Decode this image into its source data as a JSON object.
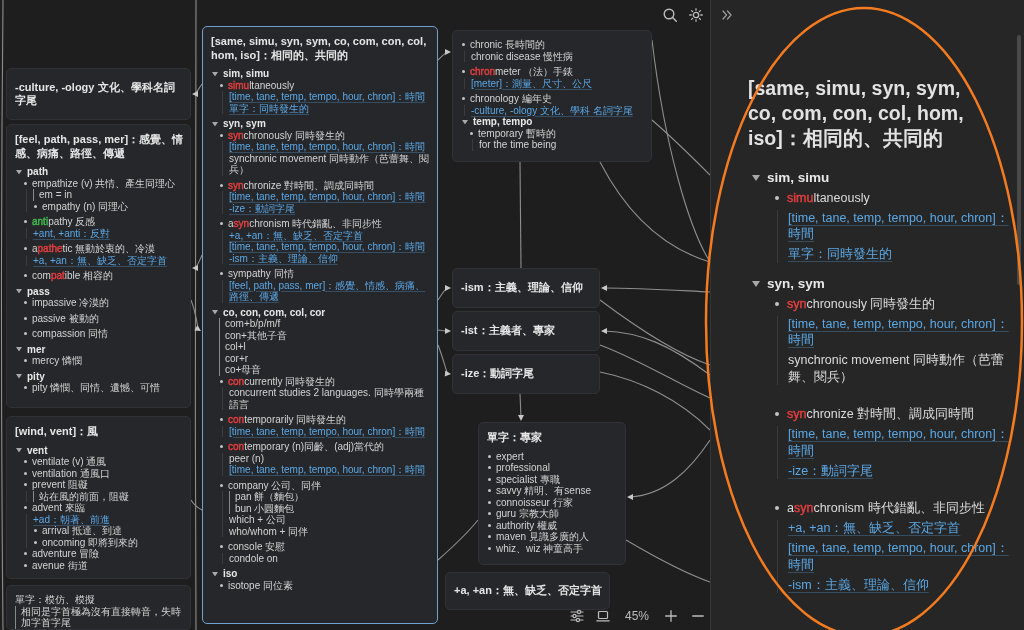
{
  "canvas": {
    "cards": [
      {
        "title": "-culture, -ology 文化、學科名詞字尾",
        "selected": false
      },
      {
        "title": "[feel, path, pass, mer]：感覺、情感、病痛、路徑、傳遞",
        "selected": false,
        "spaced": true,
        "items": [
          {
            "kind": "section",
            "text": "path",
            "expanded": true,
            "children": [
              {
                "kind": "bullet",
                "text": "empathize (v) 共情、產生同理心",
                "children": [
                  {
                    "kind": "quote",
                    "lines": [
                      "em = in"
                    ]
                  },
                  {
                    "kind": "bullet",
                    "text": "empathy (n) 同理心"
                  }
                ]
              },
              {
                "kind": "bullet",
                "parts": [
                  {
                    "text": "anti",
                    "color": "#3fb950"
                  },
                  {
                    "text": "pathy 反感"
                  }
                ],
                "children": [
                  {
                    "kind": "link",
                    "text": "+ant, +anti：反對"
                  }
                ]
              },
              {
                "kind": "bullet",
                "parts": [
                  {
                    "text": "a"
                  },
                  {
                    "text": "pathe",
                    "color": "#e03e3e"
                  },
                  {
                    "text": "tic 無動於衷的、冷漠"
                  }
                ],
                "children": [
                  {
                    "kind": "link",
                    "text": "+a, +an：無、缺乏、否定字首"
                  }
                ]
              },
              {
                "kind": "bullet",
                "parts": [
                  {
                    "text": "com"
                  },
                  {
                    "text": "pat",
                    "color": "#e03e3e"
                  },
                  {
                    "text": "ible 相容的"
                  }
                ]
              }
            ]
          },
          {
            "kind": "section",
            "text": "pass",
            "expanded": true,
            "children": [
              {
                "kind": "bullet",
                "text": "impassive 冷漠的"
              },
              {
                "kind": "bullet",
                "text": "passive 被動的"
              },
              {
                "kind": "bullet",
                "text": "compassion 同情"
              }
            ]
          },
          {
            "kind": "section",
            "text": "mer",
            "expanded": true,
            "children": [
              {
                "kind": "bullet",
                "text": "mercy 憐憫"
              }
            ]
          },
          {
            "kind": "section",
            "text": "pity",
            "expanded": true,
            "children": [
              {
                "kind": "bullet",
                "text": "pity 憐憫、同情、遺憾、可惜"
              }
            ]
          }
        ]
      },
      {
        "title": "[wind, vent]：風",
        "selected": false,
        "spaced": false,
        "items": [
          {
            "kind": "section",
            "text": "vent",
            "expanded": true,
            "children": [
              {
                "kind": "bullet",
                "text": "ventilate (v) 通風"
              },
              {
                "kind": "bullet",
                "text": "ventilation 通風口"
              },
              {
                "kind": "bullet",
                "text": "prevent 阻礙",
                "children": [
                  {
                    "kind": "quote",
                    "lines": [
                      "站在風的前面，阻礙"
                    ]
                  }
                ]
              },
              {
                "kind": "bullet",
                "text": "advent 來臨",
                "children": [
                  {
                    "kind": "link",
                    "text": "+ad：朝著、前進"
                  },
                  {
                    "kind": "bullet",
                    "text": "arrival 抵達、到達"
                  },
                  {
                    "kind": "bullet",
                    "text": "oncoming 即將到來的"
                  }
                ]
              },
              {
                "kind": "bullet",
                "text": "adventure 冒險"
              },
              {
                "kind": "bullet",
                "text": "avenue 街道"
              }
            ]
          }
        ]
      },
      {
        "selected": false,
        "items": [
          {
            "kind": "note",
            "text": "單字：模仿、模擬"
          },
          {
            "kind": "quote",
            "lines": [
              "相同是字首極為沒有直接轉音，失時加字首字尾"
            ]
          }
        ]
      },
      {
        "title": "[same, simu, syn, sym, co, com, con, col, hom, iso]：相同的、共同的",
        "selected": true,
        "spaced": true,
        "items": [
          {
            "kind": "section",
            "text": "sim, simu",
            "expanded": true,
            "children": [
              {
                "kind": "bullet",
                "parts": [
                  {
                    "text": "simu",
                    "color": "#e03e3e"
                  },
                  {
                    "text": "ltaneously"
                  }
                ],
                "children": [
                  {
                    "kind": "link",
                    "text": "[time, tane, temp, tempo, hour, chron]：時間"
                  },
                  {
                    "kind": "link",
                    "text": "單字：同時發生的"
                  }
                ]
              }
            ]
          },
          {
            "kind": "section",
            "text": "syn, sym",
            "expanded": true,
            "children": [
              {
                "kind": "bullet",
                "parts": [
                  {
                    "text": "syn",
                    "color": "#e03e3e"
                  },
                  {
                    "text": "chronously 同時發生的"
                  }
                ],
                "children": [
                  {
                    "kind": "link",
                    "text": "[time, tane, temp, tempo, hour, chron]：時間"
                  },
                  {
                    "kind": "note",
                    "text": "synchronic movement 同時動作（芭蕾舞、閱兵）"
                  }
                ]
              },
              {
                "kind": "bullet",
                "parts": [
                  {
                    "text": "syn",
                    "color": "#e03e3e"
                  },
                  {
                    "text": "chronize 對時間、調成同時間"
                  }
                ],
                "children": [
                  {
                    "kind": "link",
                    "text": "[time, tane, temp, tempo, hour, chron]：時間"
                  },
                  {
                    "kind": "link",
                    "text": "-ize：動詞字尾"
                  }
                ]
              },
              {
                "kind": "bullet",
                "parts": [
                  {
                    "text": "a"
                  },
                  {
                    "text": "syn",
                    "color": "#e03e3e"
                  },
                  {
                    "text": "chronism 時代錯亂、非同步性"
                  }
                ],
                "children": [
                  {
                    "kind": "link",
                    "text": "+a, +an：無、缺乏、否定字首"
                  },
                  {
                    "kind": "link",
                    "text": "[time, tane, temp, tempo, hour, chron]：時間"
                  },
                  {
                    "kind": "link",
                    "text": "-ism：主義、理論、信仰"
                  }
                ]
              },
              {
                "kind": "bullet",
                "text": "sympathy 同情",
                "children": [
                  {
                    "kind": "link",
                    "text": "[feel, path, pass, mer]：感覺、情感、病痛、路徑、傳遞"
                  }
                ]
              }
            ]
          },
          {
            "kind": "section",
            "text": "co, con, com, col, cor",
            "expanded": true,
            "children": [
              {
                "kind": "quote",
                "lines": [
                  "com+b/p/m/f",
                  "con+其他子音",
                  "col+l",
                  "cor+r",
                  "co+母音"
                ]
              },
              {
                "kind": "bullet",
                "parts": [
                  {
                    "text": "con",
                    "color": "#e03e3e"
                  },
                  {
                    "text": "currently 同時發生的"
                  }
                ],
                "children": [
                  {
                    "kind": "note",
                    "text": "concurrent studies 2 languages. 同時學兩種語言"
                  }
                ]
              },
              {
                "kind": "bullet",
                "parts": [
                  {
                    "text": "con",
                    "color": "#e03e3e"
                  },
                  {
                    "text": "temporarily 同時發生的"
                  }
                ],
                "children": [
                  {
                    "kind": "link",
                    "text": "[time, tane, temp, tempo, hour, chron]：時間"
                  }
                ]
              },
              {
                "kind": "bullet",
                "parts": [
                  {
                    "text": "con",
                    "color": "#e03e3e"
                  },
                  {
                    "text": "temporary (n)同齡、(adj)當代的"
                  }
                ],
                "children": [
                  {
                    "kind": "note",
                    "text": "peer (n)"
                  },
                  {
                    "kind": "link",
                    "text": "[time, tane, temp, tempo, hour, chron]：時間"
                  }
                ]
              },
              {
                "kind": "bullet",
                "text": "company 公司、同伴",
                "children": [
                  {
                    "kind": "quote",
                    "lines": [
                      "pan 餅（麵包）",
                      "bun 小圓麵包"
                    ]
                  },
                  {
                    "kind": "note",
                    "text": "which + 公司"
                  },
                  {
                    "kind": "note",
                    "text": "who/whom + 同伴"
                  }
                ]
              },
              {
                "kind": "bullet",
                "text": "console 安慰",
                "children": [
                  {
                    "kind": "note",
                    "text": "condole on"
                  }
                ]
              }
            ]
          },
          {
            "kind": "section",
            "text": "iso",
            "expanded": true,
            "children": [
              {
                "kind": "bullet",
                "text": "isotope 同位素"
              }
            ]
          }
        ]
      },
      {
        "selected": false,
        "spaced": true,
        "items": [
          {
            "kind": "bullet",
            "text": "chronic 長時間的",
            "children": [
              {
                "kind": "note",
                "text": "chronic disease 慢性病"
              }
            ]
          },
          {
            "kind": "bullet",
            "parts": [
              {
                "text": "chron",
                "color": "#e03e3e"
              },
              {
                "text": "meter （法）手錶"
              }
            ],
            "children": [
              {
                "kind": "link",
                "text": "[meter]：測量、尺寸、公尺"
              }
            ]
          },
          {
            "kind": "bullet",
            "text": "chronology 編年史",
            "children": [
              {
                "kind": "link",
                "text": "-culture, -ology 文化、學科 名詞字尾"
              }
            ]
          },
          {
            "kind": "section",
            "text": "temp, tempo",
            "expanded": true,
            "children": [
              {
                "kind": "bullet",
                "text": "temporary 暫時的",
                "children": [
                  {
                    "kind": "note",
                    "text": "for the time being"
                  }
                ]
              }
            ]
          }
        ]
      },
      {
        "title": "-ism：主義、理論、信仰",
        "selected": false
      },
      {
        "title": "-ist：主義者、專家",
        "selected": false
      },
      {
        "title": "-ize：動詞字尾",
        "selected": false
      },
      {
        "title": "單字：專家",
        "selected": false,
        "spaced": false,
        "items": [
          {
            "kind": "bullet",
            "text": "expert"
          },
          {
            "kind": "bullet",
            "text": "professional"
          },
          {
            "kind": "bullet",
            "text": "specialist 專職"
          },
          {
            "kind": "bullet",
            "text": "savvy 精明、有sense"
          },
          {
            "kind": "bullet",
            "text": "connoisseur 行家"
          },
          {
            "kind": "bullet",
            "text": "guru 宗教大師"
          },
          {
            "kind": "bullet",
            "text": "authority 權威"
          },
          {
            "kind": "bullet",
            "text": "maven 見識多廣的人"
          },
          {
            "kind": "bullet",
            "text": "whiz、wiz 神童高手"
          }
        ]
      },
      {
        "title": "+a, +an：無、缺乏、否定字首",
        "selected": false
      }
    ],
    "toolbar": {
      "zoom": "45%"
    }
  },
  "panel": {
    "title": "[same, simu, syn, sym, co, com, con, col, hom, iso]：相同的、共同的",
    "spaced": true,
    "items": [
      {
        "kind": "section",
        "text": "sim, simu",
        "expanded": true,
        "children": [
          {
            "kind": "bullet",
            "parts": [
              {
                "text": "simu",
                "color": "#e03e3e"
              },
              {
                "text": "ltaneously"
              }
            ],
            "children": [
              {
                "kind": "link",
                "text": "[time, tane, temp, tempo, hour, chron]：時間"
              },
              {
                "kind": "link",
                "text": "單字：同時發生的"
              }
            ]
          }
        ]
      },
      {
        "kind": "section",
        "text": "syn, sym",
        "expanded": true,
        "children": [
          {
            "kind": "bullet",
            "parts": [
              {
                "text": "syn",
                "color": "#e03e3e"
              },
              {
                "text": "chronously 同時發生的"
              }
            ],
            "children": [
              {
                "kind": "link",
                "text": "[time, tane, temp, tempo, hour, chron]：時間"
              },
              {
                "kind": "note",
                "text": "synchronic movement 同時動作（芭蕾舞、閱兵）"
              }
            ]
          },
          {
            "kind": "bullet",
            "parts": [
              {
                "text": "syn",
                "color": "#e03e3e"
              },
              {
                "text": "chronize 對時間、調成同時間"
              }
            ],
            "children": [
              {
                "kind": "link",
                "text": "[time, tane, temp, tempo, hour, chron]：時間"
              },
              {
                "kind": "link",
                "text": "-ize：動詞字尾"
              }
            ]
          },
          {
            "kind": "bullet",
            "parts": [
              {
                "text": "a"
              },
              {
                "text": "syn",
                "color": "#e03e3e"
              },
              {
                "text": "chronism 時代錯亂、非同步性"
              }
            ],
            "children": [
              {
                "kind": "link",
                "text": "+a, +an：無、缺乏、否定字首"
              },
              {
                "kind": "link",
                "text": "[time, tane, temp, tempo, hour, chron]：時間"
              },
              {
                "kind": "link",
                "text": "-ism：主義、理論、信仰"
              }
            ]
          }
        ]
      }
    ]
  }
}
